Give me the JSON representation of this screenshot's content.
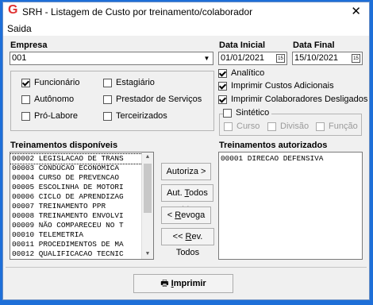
{
  "window": {
    "title": "SRH - Listagem de Custo por treinamento/colaborador",
    "close_glyph": "✕",
    "app_icon": "G",
    "app_icon_color": "#e03030"
  },
  "menu": {
    "items": [
      "Saida"
    ]
  },
  "empresa": {
    "label": "Empresa",
    "value": "001"
  },
  "dates": {
    "inicial_label": "Data Inicial",
    "inicial_value": "01/01/2021",
    "final_label": "Data Final",
    "final_value": "15/10/2021",
    "calendar_glyph": "15"
  },
  "types": [
    {
      "label": "Funcionário",
      "checked": true
    },
    {
      "label": "Estagiário",
      "checked": false
    },
    {
      "label": "Autônomo",
      "checked": false
    },
    {
      "label": "Prestador de Serviços",
      "checked": false
    },
    {
      "label": "Pró-Labore",
      "checked": false
    },
    {
      "label": "Terceirizados",
      "checked": false
    }
  ],
  "options": [
    {
      "label": "Analítico",
      "checked": true
    },
    {
      "label": "Imprimir Custos Adicionais",
      "checked": true
    },
    {
      "label": "Imprimir Colaboradores Desligados",
      "checked": true
    }
  ],
  "sintetico": {
    "label": "Sintético",
    "checked": false,
    "sub": [
      "Curso",
      "Divisão",
      "Função"
    ]
  },
  "disponiveis": {
    "label": "Treinamentos disponíveis",
    "items": [
      "00002 LEGISLACAO DE TRANS",
      "00003 CONDUCAO ECONOMICA",
      "00004 CURSO DE PREVENCAO",
      "00005 ESCOLINHA DE MOTORI",
      "00006 CICLO DE APRENDIZAG",
      "00007 TREINAMENTO PPR",
      "00008 TREINAMENTO ENVOLVI",
      "00009 NÃO COMPARECEU NO T",
      "00010 TELEMETRIA",
      "00011 PROCEDIMENTOS DE MA",
      "00012 QUALIFICACAO TECNIC"
    ]
  },
  "autorizados": {
    "label": "Treinamentos autorizados",
    "items": [
      "00001 DIRECAO DEFENSIVA"
    ]
  },
  "buttons": {
    "autoriza": "Autoriza >",
    "aut_todos_pre": "Aut. ",
    "aut_todos_u": "T",
    "aut_todos_post": "odos >>",
    "revoga_pre": "< ",
    "revoga_u": "R",
    "revoga_post": "evoga",
    "rev_todos_pre": "<< ",
    "rev_todos_u": "R",
    "rev_todos_post": "ev. Todos",
    "imprimir_u": "I",
    "imprimir_post": "mprimir",
    "print_icon_glyph": "🖶",
    "scroll_up_glyph": "▲",
    "scroll_down_glyph": "▼",
    "combo_arrow_glyph": "▼"
  }
}
